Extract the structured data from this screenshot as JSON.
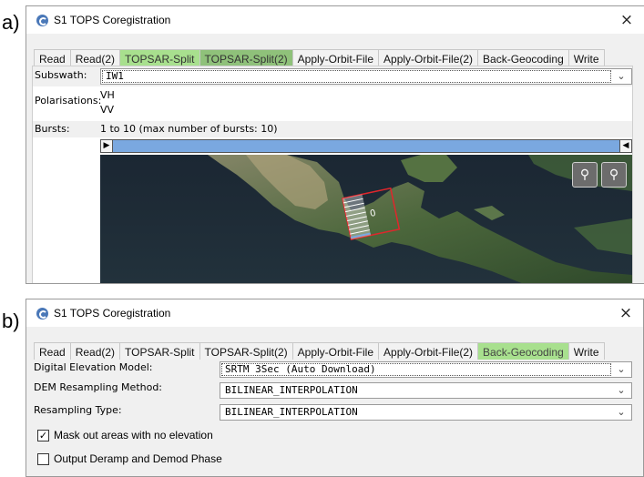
{
  "panel_a": {
    "label": "a)",
    "window_title": "S1 TOPS Coregistration",
    "close_glyph": "×",
    "tabs": [
      {
        "label": "Read",
        "style": "normal"
      },
      {
        "label": "Read(2)",
        "style": "normal"
      },
      {
        "label": "TOPSAR-Split",
        "style": "hl1"
      },
      {
        "label": "TOPSAR-Split(2)",
        "style": "hl2"
      },
      {
        "label": "Apply-Orbit-File",
        "style": "normal"
      },
      {
        "label": "Apply-Orbit-File(2)",
        "style": "normal"
      },
      {
        "label": "Back-Geocoding",
        "style": "normal"
      },
      {
        "label": "Write",
        "style": "normal"
      }
    ],
    "subswath_label": "Subswath:",
    "subswath_value": "IW1",
    "polarisations_label": "Polarisations:",
    "polarisations": [
      "VH",
      "VV"
    ],
    "bursts_label": "Bursts:",
    "bursts_text": "1 to 10 (max number of bursts: 10)",
    "burst_marker": "0",
    "icons": {
      "zoom_all": "zoom-all-icon",
      "pan": "pan-icon",
      "window": "app-icon"
    }
  },
  "panel_b": {
    "label": "b)",
    "window_title": "S1 TOPS Coregistration",
    "close_glyph": "×",
    "tabs": [
      {
        "label": "Read",
        "style": "normal"
      },
      {
        "label": "Read(2)",
        "style": "normal"
      },
      {
        "label": "TOPSAR-Split",
        "style": "normal"
      },
      {
        "label": "TOPSAR-Split(2)",
        "style": "normal"
      },
      {
        "label": "Apply-Orbit-File",
        "style": "normal"
      },
      {
        "label": "Apply-Orbit-File(2)",
        "style": "normal"
      },
      {
        "label": "Back-Geocoding",
        "style": "green"
      },
      {
        "label": "Write",
        "style": "normal"
      }
    ],
    "dem_label": "Digital Elevation Model:",
    "dem_value": "SRTM 3Sec (Auto Download)",
    "dem_resampling_label": "DEM Resampling Method:",
    "dem_resampling_value": "BILINEAR_INTERPOLATION",
    "resampling_type_label": "Resampling Type:",
    "resampling_type_value": "BILINEAR_INTERPOLATION",
    "mask_label": "Mask out areas with no elevation",
    "mask_checked": true,
    "deramp_label": "Output Deramp and Demod Phase",
    "deramp_checked": false
  },
  "colors": {
    "tab_highlight": "#a8e08e",
    "tab_highlight_dark": "#8fc17a",
    "slider_fill": "#7aa8e0",
    "footprint": "#e0262c"
  }
}
